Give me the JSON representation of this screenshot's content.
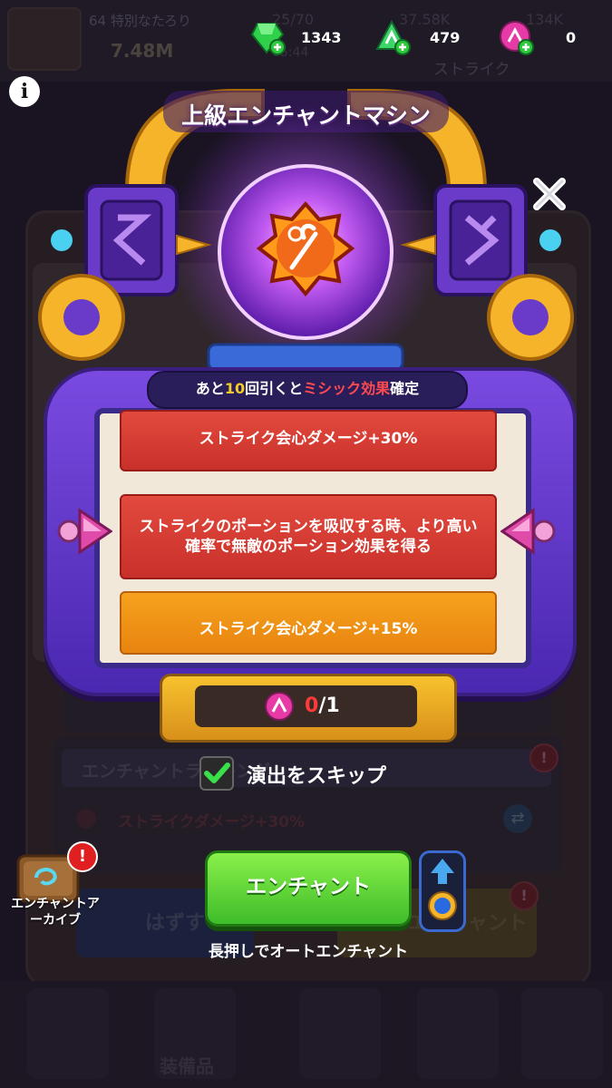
{
  "currencies": [
    {
      "icon": "green-gem-icon",
      "value": "1343"
    },
    {
      "icon": "enchant-stone-green-icon",
      "value": "479"
    },
    {
      "icon": "enchant-stone-pink-icon",
      "value": "0"
    }
  ],
  "background": {
    "player_name": "64 特別なたろり",
    "power": "7.48M",
    "stamina": "25/70",
    "timer": "05:44",
    "mid_value_a": "37.58K",
    "mid_value_b": "134K",
    "strike_label": "ストライク",
    "lock_title": "エンチャントラッキング",
    "stat_line": "ストライクダメージ+30%",
    "remove_button": "はずす",
    "enchant_button_bg": "エンチャント",
    "tab_equipment": "装備品",
    "alert": "!"
  },
  "machine": {
    "title": "上級エンチャントマシン",
    "notice_prefix": "あと",
    "notice_count": "10",
    "notice_mid": "回引くと",
    "notice_highlight": "ミシック効果",
    "notice_suffix": "確定",
    "slots": [
      {
        "text": "ストライク会心ダメージ+30%",
        "color": "#d63c33"
      },
      {
        "text": "ストライクのポーションを吸収する時、より高い確率で無敵のポーション効果を得る",
        "color": "#d63c33"
      },
      {
        "text": "ストライク会心ダメージ+15%",
        "color": "#f09a1a"
      }
    ],
    "counter_current": "0",
    "counter_total": "/1",
    "counter_icon": "enchant-stone-pink-icon"
  },
  "controls": {
    "skip_label": "演出をスキップ",
    "skip_checked": true,
    "enchant_label": "エンチャント",
    "hold_hint": "長押しでオートエンチャント",
    "archive_label": "エンチャントアーカイブ",
    "archive_badge": "!"
  }
}
